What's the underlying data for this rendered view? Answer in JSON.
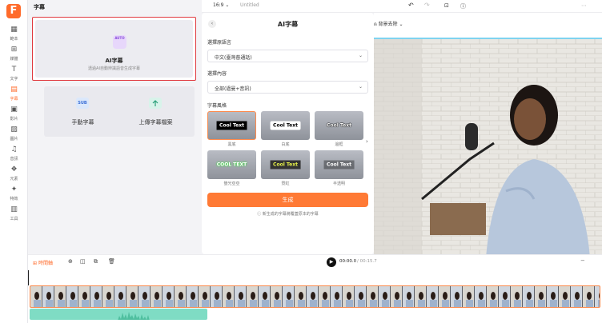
{
  "app": {
    "logo_letter": "F"
  },
  "sidebar": {
    "items": [
      {
        "label": "範本",
        "icon": "template-icon"
      },
      {
        "label": "媒體",
        "icon": "media-icon"
      },
      {
        "label": "文字",
        "icon": "text-icon"
      },
      {
        "label": "字幕",
        "icon": "subtitle-icon",
        "active": true
      },
      {
        "label": "影片",
        "icon": "video-icon"
      },
      {
        "label": "圖片",
        "icon": "image-icon"
      },
      {
        "label": "音訊",
        "icon": "music-icon"
      },
      {
        "label": "元素",
        "icon": "elements-icon"
      },
      {
        "label": "特效",
        "icon": "effects-icon"
      },
      {
        "label": "工具",
        "icon": "tools-icon"
      }
    ]
  },
  "subtitle_panel": {
    "title": "字幕",
    "ai_card": {
      "badge": "AUTO",
      "title": "AI字幕",
      "desc": "透過AI自動辨識語音生成字幕"
    },
    "manual_label": "手動字幕",
    "manual_badge": "SUB",
    "upload_label": "上傳字幕檔案"
  },
  "topbar": {
    "aspect_ratio": "16:9",
    "doc_title": "Untitled"
  },
  "ai_dialog": {
    "title": "AI字幕",
    "language_label": "選擇原語言",
    "language_value": "中文(臺灣普通話)",
    "content_label": "選擇內容",
    "content_value": "全部(過曼+音訊)",
    "style_label": "字幕風格",
    "styles": [
      {
        "text": "Cool Text",
        "caption": "黑底"
      },
      {
        "text": "Cool Text",
        "caption": "白底"
      },
      {
        "text": "Cool Text",
        "caption": "邊框"
      },
      {
        "text": "COOL TEXT",
        "caption": "螢光亞亞"
      },
      {
        "text": "Cool Text",
        "caption": "霓虹"
      },
      {
        "text": "Cool Text",
        "caption": "半透明"
      }
    ],
    "generate_label": "生成",
    "note": "新生成的字幕將覆蓋原本的字幕"
  },
  "preview": {
    "tool_label": "背景去除"
  },
  "timeline": {
    "label": "時間軸",
    "current_time": "00:00.0",
    "duration": "/ 00:15.7"
  },
  "colors": {
    "accent": "#ff7a35",
    "highlight_border": "#e0393e",
    "audio": "#7fdcc4"
  }
}
